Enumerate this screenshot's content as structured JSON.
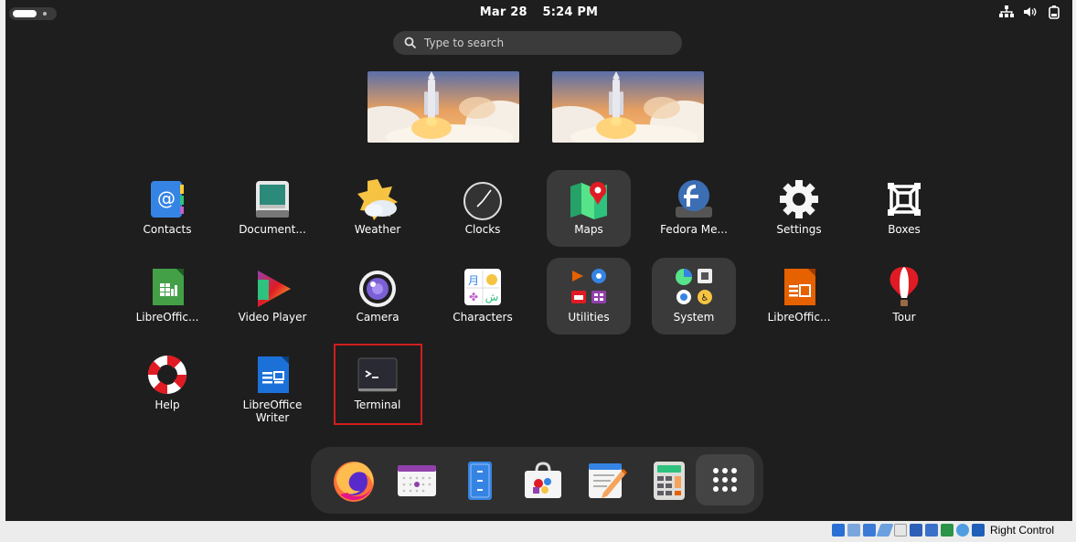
{
  "topbar": {
    "date": "Mar 28",
    "time": "5:24 PM"
  },
  "search": {
    "placeholder": "Type to search"
  },
  "apps": [
    {
      "label": "Contacts"
    },
    {
      "label": "Document..."
    },
    {
      "label": "Weather"
    },
    {
      "label": "Clocks"
    },
    {
      "label": "Maps"
    },
    {
      "label": "Fedora Me..."
    },
    {
      "label": "Settings"
    },
    {
      "label": "Boxes"
    },
    {
      "label": "LibreOffic..."
    },
    {
      "label": "Video Player"
    },
    {
      "label": "Camera"
    },
    {
      "label": "Characters"
    },
    {
      "label": "Utilities"
    },
    {
      "label": "System"
    },
    {
      "label": "LibreOffic..."
    },
    {
      "label": "Tour"
    },
    {
      "label": "Help"
    },
    {
      "label": "LibreOffice\nWriter"
    },
    {
      "label": "Terminal"
    }
  ],
  "dash": [
    "firefox-icon",
    "calendar-icon",
    "files-icon",
    "software-icon",
    "text-editor-icon",
    "calculator-icon",
    "show-apps-icon"
  ],
  "hostbar": {
    "label": "Right Control"
  },
  "colors": {
    "background": "#1e1e1e",
    "highlight": "#d11d1d",
    "folder": "#3a3a3a"
  }
}
